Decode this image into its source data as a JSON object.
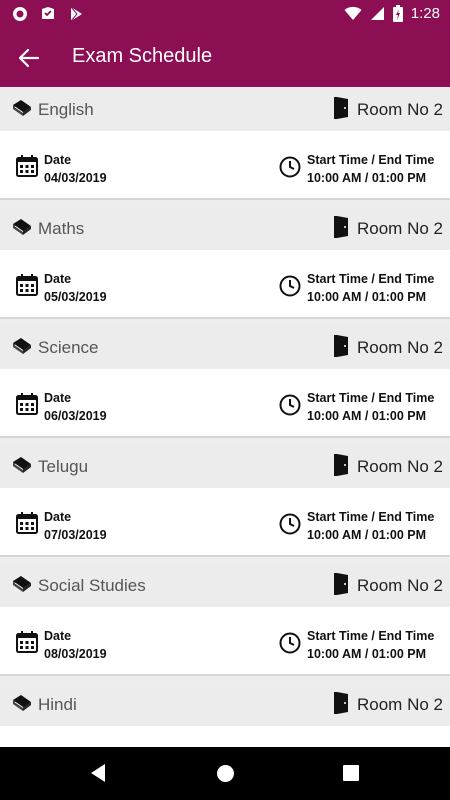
{
  "status_bar": {
    "time": "1:28",
    "left_icons": [
      "circle-notification-icon",
      "inbox-check-icon",
      "play-store-icon"
    ],
    "right_icons": [
      "wifi-icon",
      "signal-icon",
      "battery-charging-icon"
    ]
  },
  "app_bar": {
    "title": "Exam Schedule",
    "back_icon": "arrow-back-icon",
    "color": "#8c0f53"
  },
  "labels": {
    "date": "Date",
    "time": "Start Time / End Time"
  },
  "exams": [
    {
      "subject": "English",
      "room": "Room No 2",
      "date": "04/03/2019",
      "time": "10:00 AM / 01:00 PM"
    },
    {
      "subject": "Maths",
      "room": "Room No 2",
      "date": "05/03/2019",
      "time": "10:00 AM / 01:00 PM"
    },
    {
      "subject": "Science",
      "room": "Room No 2",
      "date": "06/03/2019",
      "time": "10:00 AM / 01:00 PM"
    },
    {
      "subject": "Telugu",
      "room": "Room No 2",
      "date": "07/03/2019",
      "time": "10:00 AM / 01:00 PM"
    },
    {
      "subject": "Social Studies",
      "room": "Room No 2",
      "date": "08/03/2019",
      "time": "10:00 AM / 01:00 PM"
    },
    {
      "subject": "Hindi",
      "room": "Room No 2",
      "date": "",
      "time": ""
    }
  ],
  "nav_bar": {
    "buttons": [
      "back-triangle-icon",
      "home-circle-icon",
      "recents-square-icon"
    ]
  }
}
